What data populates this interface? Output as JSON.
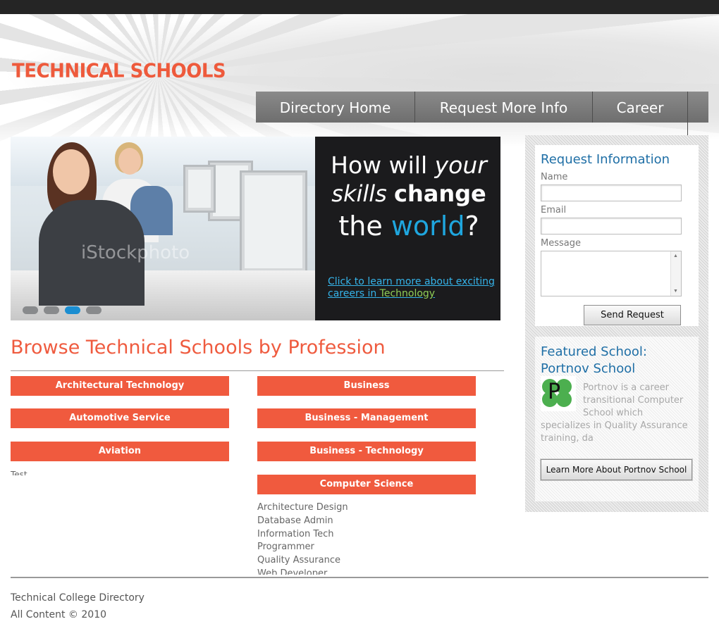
{
  "header": {
    "logo_text": "TECHNICAL SCHOOLS"
  },
  "nav": {
    "items": [
      {
        "label": "Directory Home"
      },
      {
        "label": "Request More Info"
      },
      {
        "label": "Career"
      }
    ]
  },
  "banner": {
    "headline_line1_a": "How will",
    "headline_line1_b": "your",
    "headline_line2_a": "skills",
    "headline_line2_b": "change",
    "headline_line3_a": "the",
    "headline_line3_b": "world",
    "headline_line3_c": "?",
    "link_text_a": "Click to learn more about exciting careers in",
    "link_text_b": "Technology",
    "watermark": "iStockphoto",
    "slide_count": 4,
    "active_slide": 3
  },
  "browse": {
    "title": "Browse Technical Schools by Profession",
    "column1": [
      {
        "label": "Architectural Technology"
      },
      {
        "label": "Automotive Service"
      },
      {
        "label": "Aviation"
      }
    ],
    "column1_extra": "Test",
    "column2": [
      {
        "label": "Business"
      },
      {
        "label": "Business - Management"
      },
      {
        "label": "Business - Technology"
      },
      {
        "label": "Computer Science"
      }
    ],
    "computer_science_sublist": [
      "Architecture Design",
      "Database Admin",
      "Information Tech",
      "Programmer",
      "Quality Assurance",
      "Web Developer"
    ]
  },
  "sidebar": {
    "request": {
      "title": "Request Information",
      "name_label": "Name",
      "name_value": "",
      "email_label": "Email",
      "email_value": "",
      "message_label": "Message",
      "message_value": "",
      "send_label": "Send Request"
    },
    "featured": {
      "title_line1": "Featured School:",
      "title_line2": "Portnov School",
      "logo_letter": "P",
      "description": "Portnov is a career transitional Computer School which specializes in Quality Assurance training, da",
      "learn_more_label": "Learn More About Portnov School"
    }
  },
  "footer": {
    "line1": "Technical College Directory",
    "line2": "All Content © 2010"
  },
  "colors": {
    "accent": "#f05a3e",
    "link_blue": "#1f6fa6",
    "nav_gray": "#7a7a7a",
    "top_bar": "#252525"
  }
}
